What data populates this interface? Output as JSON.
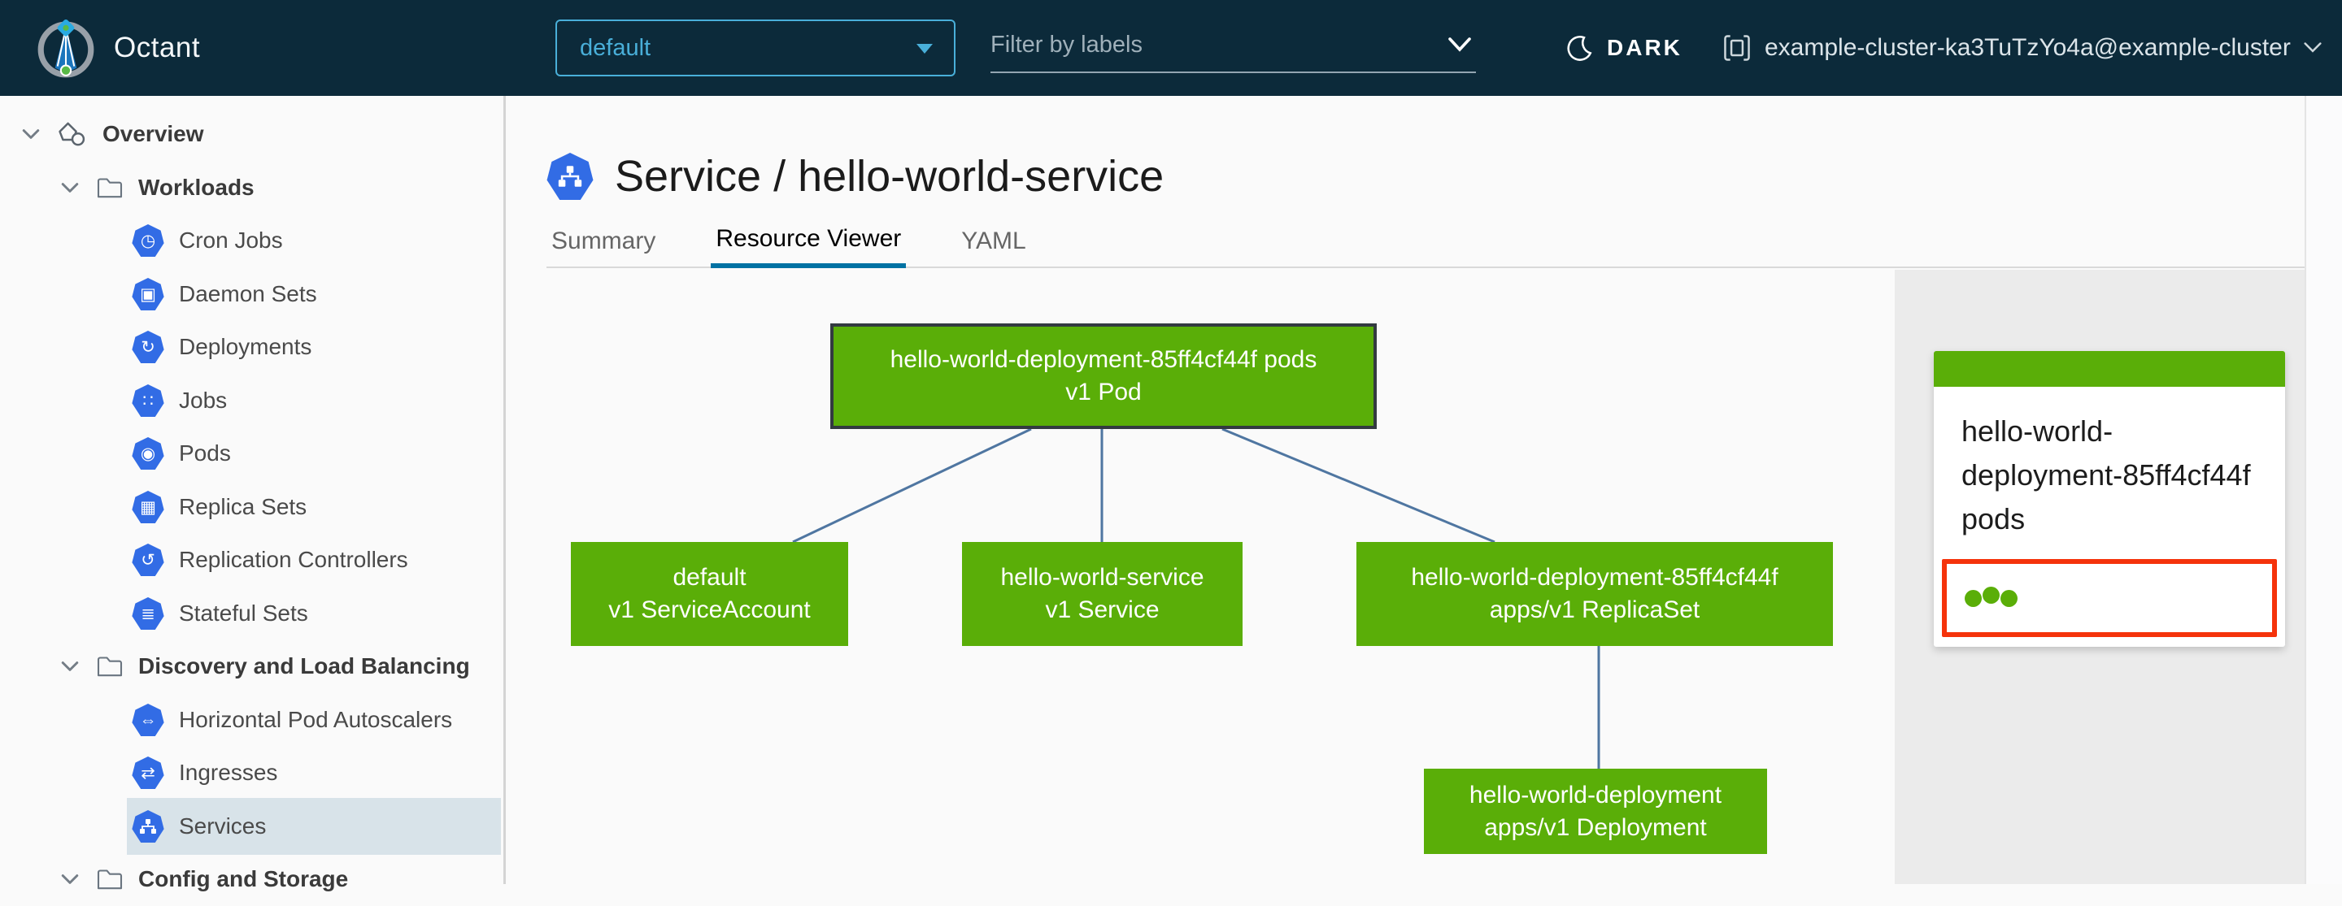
{
  "header": {
    "app_title": "Octant",
    "namespace": {
      "selected": "default"
    },
    "filter": {
      "placeholder": "Filter by labels"
    },
    "theme_toggle": {
      "label": "DARK"
    },
    "context": {
      "label": "example-cluster-ka3TuTzYo4a@example-cluster"
    }
  },
  "sidebar": {
    "items": [
      {
        "label": "Overview",
        "icon": "applications-icon",
        "level": 0,
        "expanded": true
      },
      {
        "label": "Workloads",
        "icon": "folder-icon",
        "level": 1,
        "expanded": true
      },
      {
        "label": "Cron Jobs",
        "icon": "cronjob-icon",
        "glyph": "◷",
        "level": 2
      },
      {
        "label": "Daemon Sets",
        "icon": "daemonset-icon",
        "glyph": "▣",
        "level": 2
      },
      {
        "label": "Deployments",
        "icon": "deployment-icon",
        "glyph": "↻",
        "level": 2
      },
      {
        "label": "Jobs",
        "icon": "job-icon",
        "glyph": "∷",
        "level": 2
      },
      {
        "label": "Pods",
        "icon": "pod-icon",
        "glyph": "◉",
        "level": 2
      },
      {
        "label": "Replica Sets",
        "icon": "replicaset-icon",
        "glyph": "▦",
        "level": 2
      },
      {
        "label": "Replication Controllers",
        "icon": "replicationcontroller-icon",
        "glyph": "↺",
        "level": 2
      },
      {
        "label": "Stateful Sets",
        "icon": "statefulset-icon",
        "glyph": "≣",
        "level": 2
      },
      {
        "label": "Discovery and Load Balancing",
        "icon": "folder-icon",
        "level": 1,
        "expanded": true
      },
      {
        "label": "Horizontal Pod Autoscalers",
        "icon": "hpa-icon",
        "glyph": "⇔",
        "level": 2
      },
      {
        "label": "Ingresses",
        "icon": "ingress-icon",
        "glyph": "⇄",
        "level": 2
      },
      {
        "label": "Services",
        "icon": "service-icon",
        "level": 2,
        "selected": true
      },
      {
        "label": "Config and Storage",
        "icon": "folder-icon",
        "level": 1,
        "expanded": true
      }
    ]
  },
  "main": {
    "title": "Service / hello-world-service",
    "title_icon": "service-icon",
    "tabs": [
      {
        "label": "Summary",
        "active": false
      },
      {
        "label": "Resource Viewer",
        "active": true
      },
      {
        "label": "YAML",
        "active": false
      }
    ]
  },
  "resource_viewer": {
    "type": "graph",
    "nodes": [
      {
        "id": "pod",
        "name": "hello-world-deployment-85ff4cf44f pods",
        "kind": "v1 Pod",
        "status": "ok",
        "selected": true
      },
      {
        "id": "serviceaccount",
        "name": "default",
        "kind": "v1 ServiceAccount",
        "status": "ok"
      },
      {
        "id": "service",
        "name": "hello-world-service",
        "kind": "v1 Service",
        "status": "ok"
      },
      {
        "id": "replicaset",
        "name": "hello-world-deployment-85ff4cf44f",
        "kind": "apps/v1 ReplicaSet",
        "status": "ok"
      },
      {
        "id": "deployment",
        "name": "hello-world-deployment",
        "kind": "apps/v1 Deployment",
        "status": "ok"
      }
    ],
    "edges": [
      [
        "pod",
        "serviceaccount"
      ],
      [
        "pod",
        "service"
      ],
      [
        "pod",
        "replicaset"
      ],
      [
        "replicaset",
        "deployment"
      ]
    ]
  },
  "detail_panel": {
    "card_title": "hello-world-deployment-85ff4cf44f pods",
    "status_dot_count": 3
  },
  "colors": {
    "header_bg": "#0c2a3a",
    "accent_blue": "#49afd9",
    "k8s_icon_blue": "#326ce5",
    "node_ok_green": "#5aae08",
    "edge_blue": "#4f76a1",
    "tab_active_blue": "#0072a3",
    "highlight_red": "#f5330b",
    "selected_row_bg": "#d8e3e9",
    "panel_bg": "#ebebeb"
  }
}
